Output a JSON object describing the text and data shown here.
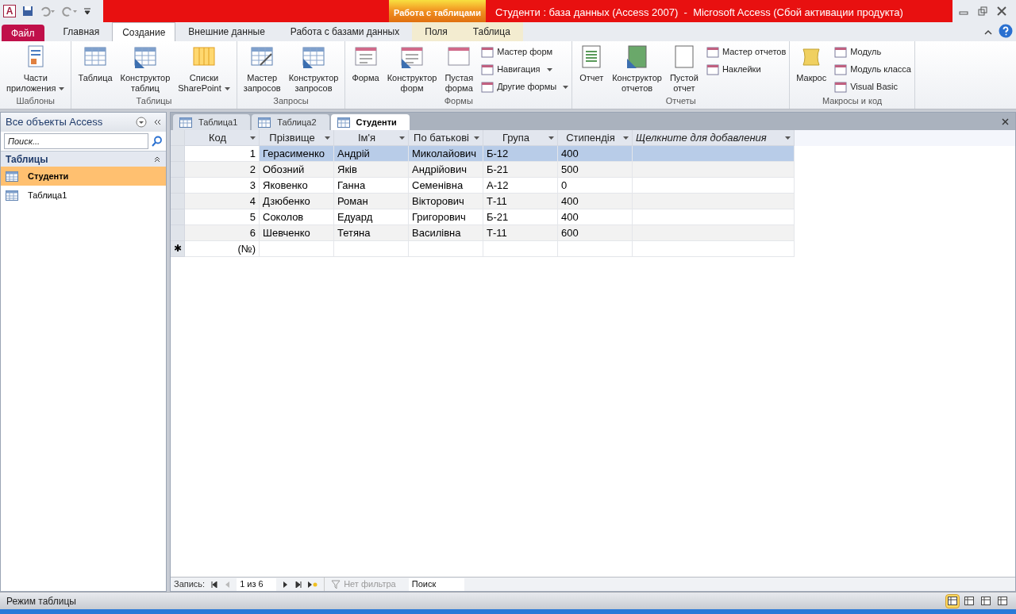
{
  "title_bar": {
    "app_icon_letter": "A",
    "context_group": "Работа с таблицами",
    "title": "Студенти : база данных (Access 2007)  -  Microsoft Access (Сбой активации продукта)"
  },
  "ribbon_tabs": [
    {
      "label": "Файл",
      "kind": "file"
    },
    {
      "label": "Главная",
      "kind": "normal",
      "selected": false
    },
    {
      "label": "Создание",
      "kind": "normal",
      "selected": true
    },
    {
      "label": "Внешние данные",
      "kind": "normal",
      "selected": false
    },
    {
      "label": "Работа с базами данных",
      "kind": "normal",
      "selected": false
    },
    {
      "label": "Поля",
      "kind": "context",
      "selected": false
    },
    {
      "label": "Таблица",
      "kind": "context",
      "selected": false
    }
  ],
  "ribbon_groups": [
    {
      "label": "Шаблоны",
      "items": [
        {
          "kind": "large",
          "lines": [
            "Части",
            "приложения"
          ],
          "dropdown": true
        }
      ]
    },
    {
      "label": "Таблицы",
      "items": [
        {
          "kind": "large",
          "lines": [
            "Таблица"
          ],
          "dropdown": false
        },
        {
          "kind": "large",
          "lines": [
            "Конструктор",
            "таблиц"
          ],
          "dropdown": false
        },
        {
          "kind": "large",
          "lines": [
            "Списки",
            "SharePoint"
          ],
          "dropdown": true
        }
      ]
    },
    {
      "label": "Запросы",
      "items": [
        {
          "kind": "large",
          "lines": [
            "Мастер",
            "запросов"
          ],
          "dropdown": false
        },
        {
          "kind": "large",
          "lines": [
            "Конструктор",
            "запросов"
          ],
          "dropdown": false
        }
      ]
    },
    {
      "label": "Формы",
      "items": [
        {
          "kind": "large",
          "lines": [
            "Форма"
          ],
          "dropdown": false
        },
        {
          "kind": "large",
          "lines": [
            "Конструктор",
            "форм"
          ],
          "dropdown": false
        },
        {
          "kind": "large",
          "lines": [
            "Пустая",
            "форма"
          ],
          "dropdown": false
        },
        {
          "kind": "small",
          "lines": [
            "Мастер форм"
          ],
          "dropdown": false
        },
        {
          "kind": "small",
          "lines": [
            "Навигация"
          ],
          "dropdown": true
        },
        {
          "kind": "small",
          "lines": [
            "Другие формы"
          ],
          "dropdown": true
        }
      ]
    },
    {
      "label": "Отчеты",
      "items": [
        {
          "kind": "large",
          "lines": [
            "Отчет"
          ],
          "dropdown": false
        },
        {
          "kind": "large",
          "lines": [
            "Конструктор",
            "отчетов"
          ],
          "dropdown": false
        },
        {
          "kind": "large",
          "lines": [
            "Пустой",
            "отчет"
          ],
          "dropdown": false
        },
        {
          "kind": "small",
          "lines": [
            "Мастер отчетов"
          ],
          "dropdown": false
        },
        {
          "kind": "small",
          "lines": [
            "Наклейки"
          ],
          "dropdown": false
        }
      ]
    },
    {
      "label": "Макросы и код",
      "items": [
        {
          "kind": "large",
          "lines": [
            "Макрос"
          ],
          "dropdown": false
        },
        {
          "kind": "small",
          "lines": [
            "Модуль"
          ],
          "dropdown": false
        },
        {
          "kind": "small",
          "lines": [
            "Модуль класса"
          ],
          "dropdown": false
        },
        {
          "kind": "small",
          "lines": [
            "Visual Basic"
          ],
          "dropdown": false
        }
      ]
    }
  ],
  "nav_pane": {
    "title": "Все объекты Access",
    "search_placeholder": "Поиск...",
    "section": "Таблицы",
    "items": [
      {
        "label": "Студенти",
        "selected": true
      },
      {
        "label": "Таблица1",
        "selected": false
      }
    ]
  },
  "doc_tabs": [
    {
      "label": "Таблица1",
      "selected": false
    },
    {
      "label": "Таблица2",
      "selected": false
    },
    {
      "label": "Студенти",
      "selected": true
    }
  ],
  "table": {
    "columns": [
      {
        "label": "Код",
        "kind": "field"
      },
      {
        "label": "Прізвище",
        "kind": "field"
      },
      {
        "label": "Ім'я",
        "kind": "field"
      },
      {
        "label": "По батькові",
        "kind": "field"
      },
      {
        "label": "Група",
        "kind": "field"
      },
      {
        "label": "Стипендія",
        "kind": "field"
      },
      {
        "label": "Щелкните для добавления",
        "kind": "add"
      }
    ],
    "rows": [
      {
        "selected": true,
        "cells": [
          "1",
          "Герасименко",
          "Андрій",
          "Миколайович",
          "Б-12",
          "400",
          ""
        ]
      },
      {
        "selected": false,
        "cells": [
          "2",
          "Обозний",
          "Яків",
          "Андрійович",
          "Б-21",
          "500",
          ""
        ]
      },
      {
        "selected": false,
        "cells": [
          "3",
          "Яковенко",
          "Ганна",
          "Семенівна",
          "А-12",
          "0",
          ""
        ]
      },
      {
        "selected": false,
        "cells": [
          "4",
          "Дзюбенко",
          "Роман",
          "Вікторович",
          "Т-11",
          "400",
          ""
        ]
      },
      {
        "selected": false,
        "cells": [
          "5",
          "Соколов",
          "Едуард",
          "Григорович",
          "Б-21",
          "400",
          ""
        ]
      },
      {
        "selected": false,
        "cells": [
          "6",
          "Шевченко",
          "Тетяна",
          "Василівна",
          "Т-11",
          "600",
          ""
        ]
      }
    ],
    "new_row": {
      "marker": "✱",
      "cells": [
        "(№)",
        "",
        "",
        "",
        "",
        "",
        ""
      ]
    }
  },
  "record_nav": {
    "label": "Запись:",
    "position": "1 из 6",
    "filter": "Нет фильтра",
    "filter_disabled": true,
    "search_placeholder": "Поиск"
  },
  "status_bar": {
    "text": "Режим таблицы",
    "views": [
      {
        "selected": true
      },
      {
        "selected": false
      },
      {
        "selected": false
      },
      {
        "selected": false
      }
    ]
  }
}
